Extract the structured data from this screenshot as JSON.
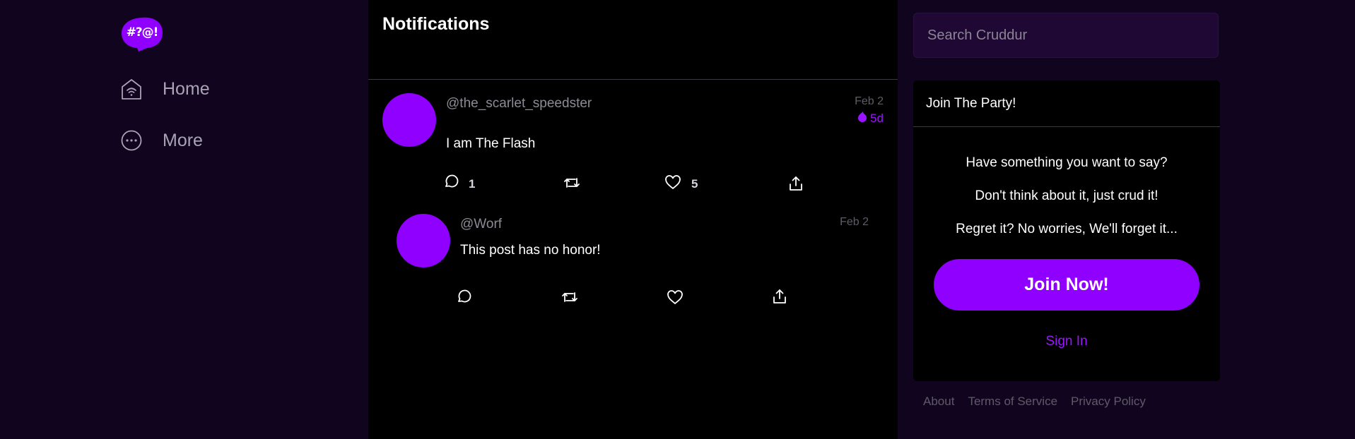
{
  "app": {
    "logo_text": "#?@!",
    "brand_color": "#8f00ff",
    "accent_color": "#9b14ff"
  },
  "sidebar": {
    "items": [
      {
        "label": "Home",
        "icon": "home-wifi-icon"
      },
      {
        "label": "More",
        "icon": "more-dots-icon"
      }
    ]
  },
  "main": {
    "title": "Notifications",
    "posts": [
      {
        "handle": "@the_scarlet_speedster",
        "date": "Feb 2",
        "age": "5d",
        "text": "I am The Flash",
        "actions": {
          "reply_count": "1",
          "like_count": "5"
        }
      },
      {
        "handle": "@Worf",
        "date": "Feb 2",
        "text": "This post has no honor!"
      }
    ]
  },
  "right": {
    "search": {
      "placeholder": "Search Cruddur"
    },
    "join_card": {
      "title": "Join The Party!",
      "lines": [
        "Have something you want to say?",
        "Don't think about it, just crud it!",
        "Regret it? No worries, We'll forget it..."
      ],
      "join_button": "Join Now!",
      "sign_in": "Sign In"
    },
    "footer": {
      "links": [
        "About",
        "Terms of Service",
        "Privacy Policy"
      ]
    }
  }
}
